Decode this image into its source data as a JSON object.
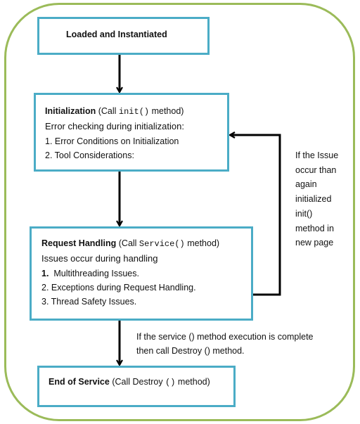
{
  "boxes": {
    "loaded": {
      "title": "Loaded and Instantiated"
    },
    "init": {
      "title": "Initialization",
      "call_prefix": "(Call ",
      "call_method": "init()",
      "call_suffix": " method)",
      "subtitle": "Error checking during initialization:",
      "items": [
        "1. Error Conditions on Initialization",
        "2. Tool Considerations:"
      ]
    },
    "request": {
      "title": "Request Handling",
      "call_prefix": "(Call ",
      "call_method": "Service()",
      "call_suffix": " method)",
      "subtitle": "Issues occur during handling",
      "items": [
        "1.",
        "Multithreading Issues.",
        "2. Exceptions during Request Handling.",
        "3. Thread Safety Issues."
      ]
    },
    "end": {
      "title": "End of Service",
      "call_prefix": "(Call Destroy ",
      "call_method": "()",
      "call_suffix": " method)"
    }
  },
  "side_note": [
    "If the Issue",
    "occur than",
    "again",
    "initialized",
    "init()",
    "method in",
    "new page"
  ],
  "bottom_note": [
    "If the service () method execution is complete",
    "then call Destroy () method."
  ],
  "colors": {
    "outer": "#9bbb59",
    "box_border": "#4bacc6",
    "arrow": "#000000"
  }
}
